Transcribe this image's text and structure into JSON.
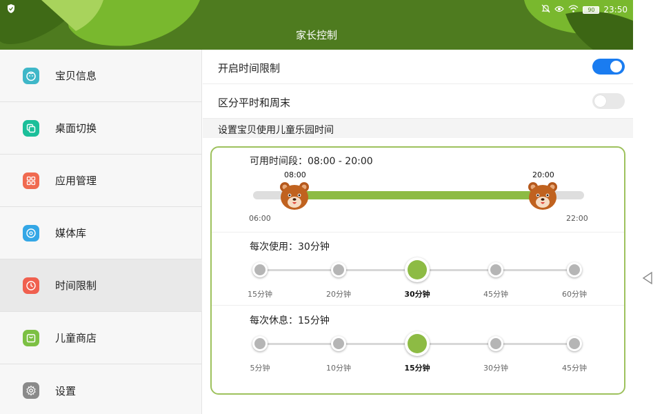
{
  "status_bar": {
    "battery": "90",
    "time": "23:50"
  },
  "header": {
    "title": "家长控制"
  },
  "sidebar": {
    "items": [
      {
        "label": "宝贝信息",
        "icon": "baby-face-icon",
        "color": "#3fb7c8"
      },
      {
        "label": "桌面切换",
        "icon": "desktop-switch-icon",
        "color": "#1bbf9a"
      },
      {
        "label": "应用管理",
        "icon": "apps-grid-icon",
        "color": "#f06a50"
      },
      {
        "label": "媒体库",
        "icon": "media-library-icon",
        "color": "#34a7e6"
      },
      {
        "label": "时间限制",
        "icon": "clock-icon",
        "color": "#f0604f",
        "active": true
      },
      {
        "label": "儿童商店",
        "icon": "shopping-bag-icon",
        "color": "#7cc043"
      },
      {
        "label": "设置",
        "icon": "gear-icon",
        "color": "#8a8a8a"
      }
    ]
  },
  "main": {
    "time_limit_toggle": {
      "label": "开启时间限制",
      "on": true
    },
    "weekday_weekend_toggle": {
      "label": "区分平时和周末",
      "on": false
    },
    "section_title": "设置宝贝使用儿童乐园时间",
    "available_period": {
      "label": "可用时间段：08:00 - 20:00",
      "min": "06:00",
      "max": "22:00",
      "start": "08:00",
      "end": "20:00",
      "range_hours": [
        6,
        22
      ],
      "selected_hours": [
        8,
        20
      ]
    },
    "each_use": {
      "label": "每次使用：30分钟",
      "options": [
        "15分钟",
        "20分钟",
        "30分钟",
        "45分钟",
        "60分钟"
      ],
      "selected_index": 2
    },
    "each_rest": {
      "label": "每次休息：15分钟",
      "options": [
        "5分钟",
        "10分钟",
        "15分钟",
        "30分钟",
        "45分钟"
      ],
      "selected_index": 2
    }
  },
  "colors": {
    "header_green": "#4e7b1f",
    "accent_green": "#8dbb44",
    "toggle_blue": "#1a7cf0",
    "card_border": "#9dc15c"
  }
}
